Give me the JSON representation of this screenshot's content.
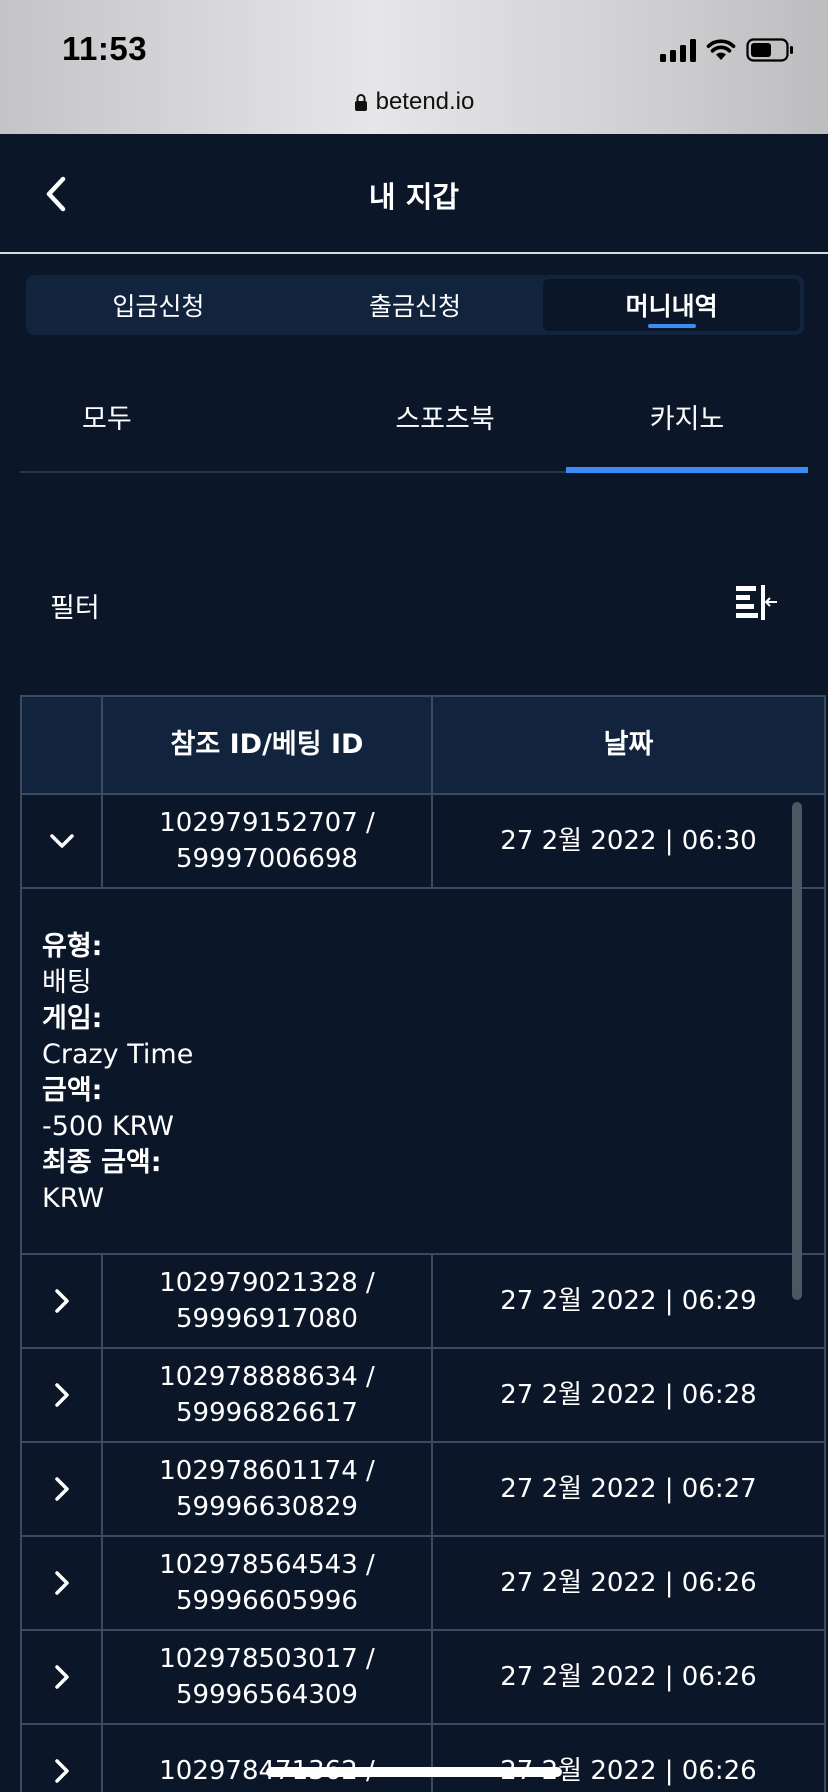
{
  "status": {
    "time": "11:53"
  },
  "browser": {
    "url": "betend.io"
  },
  "header": {
    "title": "내 지갑"
  },
  "main_tabs": [
    {
      "label": "입금신청",
      "active": false
    },
    {
      "label": "출금신청",
      "active": false
    },
    {
      "label": "머니내역",
      "active": true
    }
  ],
  "sub_tabs": [
    {
      "label": "모두",
      "active": false
    },
    {
      "label": "스포츠북",
      "active": false
    },
    {
      "label": "카지노",
      "active": true
    }
  ],
  "filter": {
    "label": "필터",
    "icon": "filter-sort-icon"
  },
  "table": {
    "headers": {
      "ref": "참조 ID/베팅 ID",
      "date": "날짜"
    },
    "rows": [
      {
        "ref_line1": "102979152707 /",
        "ref_line2": "59997006698",
        "date": "27 2월 2022 | 06:30",
        "expanded": true
      },
      {
        "ref_line1": "102979021328 /",
        "ref_line2": "59996917080",
        "date": "27 2월 2022 | 06:29"
      },
      {
        "ref_line1": "102978888634 /",
        "ref_line2": "59996826617",
        "date": "27 2월 2022 | 06:28"
      },
      {
        "ref_line1": "102978601174 /",
        "ref_line2": "59996630829",
        "date": "27 2월 2022 | 06:27"
      },
      {
        "ref_line1": "102978564543 /",
        "ref_line2": "59996605996",
        "date": "27 2월 2022 | 06:26"
      },
      {
        "ref_line1": "102978503017 /",
        "ref_line2": "59996564309",
        "date": "27 2월 2022 | 06:26"
      },
      {
        "ref_line1": "102978471362 /",
        "ref_line2": "",
        "date": "27 2월 2022 | 06:26"
      }
    ],
    "details": {
      "type_label": "유형:",
      "type_value": "배팅",
      "game_label": "게임:",
      "game_value": "Crazy Time",
      "amount_label": "금액:",
      "amount_value": "-500 KRW",
      "final_label": "최종 금액:",
      "final_value": "KRW"
    }
  },
  "colors": {
    "background": "#0b1628",
    "panel": "#12233d",
    "accent": "#3b8cf5",
    "border": "#3b4a60"
  }
}
